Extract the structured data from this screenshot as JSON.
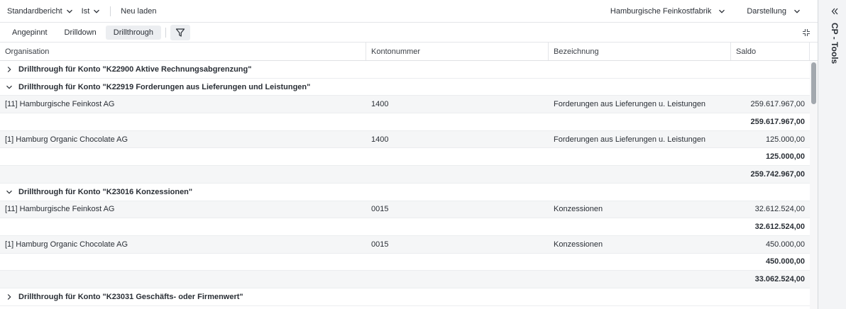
{
  "toolbar": {
    "report": "Standardbericht",
    "version": "Ist",
    "reload": "Neu laden",
    "company": "Hamburgische Feinkostfabrik",
    "display": "Darstellung"
  },
  "tabs": [
    "Angepinnt",
    "Drilldown",
    "Drillthrough"
  ],
  "active_tab": "Drillthrough",
  "columns": [
    "Organisation",
    "Kontonummer",
    "Bezeichnung",
    "Saldo"
  ],
  "rows": [
    {
      "type": "group",
      "expanded": false,
      "label": "Drillthrough für Konto \"K22900 Aktive Rechnungsabgrenzung\""
    },
    {
      "type": "group",
      "expanded": true,
      "label": "Drillthrough für Konto \"K22919 Forderungen aus Lieferungen und Leistungen\""
    },
    {
      "type": "data",
      "org": "[11] Hamburgische Feinkost AG",
      "konto": "1400",
      "bez": "Forderungen aus Lieferungen u. Leistungen",
      "saldo": "259.617.967,00"
    },
    {
      "type": "subtotal",
      "saldo": "259.617.967,00"
    },
    {
      "type": "data",
      "org": "[1] Hamburg Organic Chocolate AG",
      "konto": "1400",
      "bez": "Forderungen aus Lieferungen u. Leistungen",
      "saldo": "125.000,00"
    },
    {
      "type": "subtotal",
      "saldo": "125.000,00"
    },
    {
      "type": "total",
      "saldo": "259.742.967,00"
    },
    {
      "type": "group",
      "expanded": true,
      "label": "Drillthrough für Konto \"K23016 Konzessionen\""
    },
    {
      "type": "data",
      "org": "[11] Hamburgische Feinkost AG",
      "konto": "0015",
      "bez": "Konzessionen",
      "saldo": "32.612.524,00"
    },
    {
      "type": "subtotal",
      "saldo": "32.612.524,00"
    },
    {
      "type": "data",
      "org": "[1] Hamburg Organic Chocolate AG",
      "konto": "0015",
      "bez": "Konzessionen",
      "saldo": "450.000,00"
    },
    {
      "type": "subtotal",
      "saldo": "450.000,00"
    },
    {
      "type": "total",
      "saldo": "33.062.524,00"
    },
    {
      "type": "group",
      "expanded": false,
      "label": "Drillthrough für Konto \"K23031 Geschäfts- oder Firmenwert\""
    }
  ],
  "sidepanel": {
    "title": "CP - Tools"
  }
}
